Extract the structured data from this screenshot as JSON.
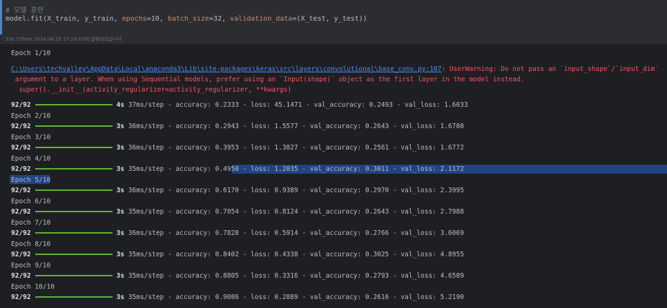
{
  "cell": {
    "comment": "# 모델 훈련",
    "code": {
      "prefix": "model.fit(X_train, y_train, ",
      "epochs_kw": "epochs",
      "epochs_val": "=10, ",
      "batch_kw": "batch_size",
      "batch_val": "=32, ",
      "val_kw": "validation_data",
      "val_val": "=(X_test, y_test))"
    }
  },
  "meta": "33s 729ms 2024.04.25 17:16:03에 실행되었습니다",
  "output": {
    "epoch1_header": "Epoch 1/10",
    "warning_link": "C:\\Users\\techvalley\\AppData\\Local\\anaconda3\\Lib\\site-packages\\keras\\src\\layers\\convolutional\\base_conv.py:107",
    "warning_msg1": ": UserWarning: Do not pass an `input_shape`/`input_dim`",
    "warning_msg2": " argument to a layer. When using Sequential models, prefer using an `Input(shape)` object as the first layer in the model instead.",
    "warning_msg3": "  super().__init__(activity_regularizer=activity_regularizer, **kwargs)",
    "epochs": [
      {
        "steps": "92/92",
        "time": "4s",
        "rest": "37ms/step - accuracy: 0.2333 - loss: 45.1471 - val_accuracy: 0.2493 - val_loss: 1.6033",
        "next": "Epoch 2/10"
      },
      {
        "steps": "92/92",
        "time": "3s",
        "rest": "36ms/step - accuracy: 0.2943 - loss: 1.5577 - val_accuracy: 0.2643 - val_loss: 1.6780",
        "next": "Epoch 3/10"
      },
      {
        "steps": "92/92",
        "time": "3s",
        "rest": "36ms/step - accuracy: 0.3953 - loss: 1.3827 - val_accuracy: 0.2561 - val_loss: 1.6772",
        "next": "Epoch 4/10"
      },
      {
        "steps": "92/92",
        "time": "3s",
        "rest": "35ms/step - accuracy: 0.4950 - loss: 1.2035 - val_accuracy: 0.3011 - val_loss: 2.1172",
        "next": "Epoch 5/10"
      },
      {
        "steps": "92/92",
        "time": "3s",
        "rest": "36ms/step - accuracy: 0.6170 - loss: 0.9389 - val_accuracy: 0.2970 - val_loss: 2.3995",
        "next": "Epoch 6/10"
      },
      {
        "steps": "92/92",
        "time": "3s",
        "rest": "35ms/step - accuracy: 0.7054 - loss: 0.8124 - val_accuracy: 0.2643 - val_loss: 2.7988",
        "next": "Epoch 7/10"
      },
      {
        "steps": "92/92",
        "time": "3s",
        "rest": "36ms/step - accuracy: 0.7828 - loss: 0.5914 - val_accuracy: 0.2766 - val_loss: 3.6069",
        "next": "Epoch 8/10"
      },
      {
        "steps": "92/92",
        "time": "3s",
        "rest": "35ms/step - accuracy: 0.8402 - loss: 0.4338 - val_accuracy: 0.3025 - val_loss: 4.8955",
        "next": "Epoch 9/10"
      },
      {
        "steps": "92/92",
        "time": "3s",
        "rest": "35ms/step - accuracy: 0.8805 - loss: 0.3316 - val_accuracy: 0.2793 - val_loss: 4.6589",
        "next": "Epoch 10/10"
      },
      {
        "steps": "92/92",
        "time": "3s",
        "rest": "35ms/step - accuracy: 0.9086 - loss: 0.2889 - val_accuracy: 0.2616 - val_loss: 5.2190",
        "next": ""
      }
    ]
  },
  "colors": {
    "progress": "#5fb832",
    "warning": "#f75464",
    "link": "#548af7",
    "selection": "#214283",
    "cell_border": "#4a88c7"
  }
}
